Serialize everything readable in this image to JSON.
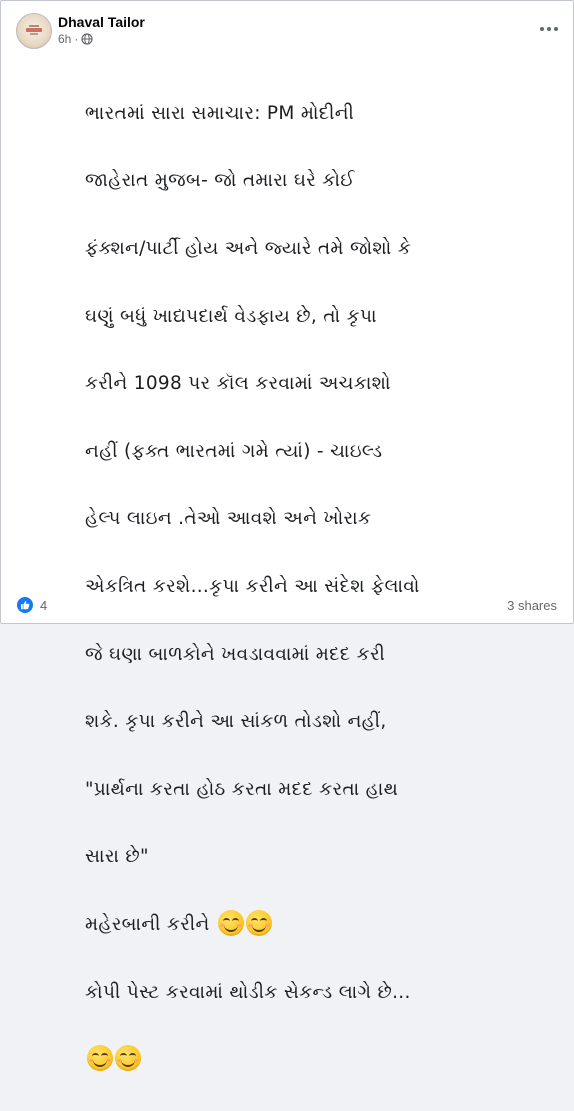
{
  "post": {
    "author": "Dhaval Tailor",
    "time": "6h",
    "privacy_icon": "globe-icon",
    "more_icon": "more-options-icon",
    "lines": [
      "ભારતમાં સારા સમાચાર: PM મોદીની",
      "જાહેરાત મુજબ- જો તમારા ઘરે કોઈ",
      "ફંક્શન/પાર્ટી હોય અને જ્યારે તમે જોશો કે",
      "ઘણું બધું ખાદ્યપદાર્થ વેડફાય છે, તો કૃપા",
      "કરીને 1098 પર કૉલ કરવામાં અચકાશો",
      "નહીં (ફક્ત ભારતમાં ગમે ત્યાં) - ચાઇલ્ડ",
      "હેલ્પ લાઇન .તેઓ આવશે અને ખોરાક",
      "એકત્રિત કરશે...કૃપા કરીને આ સંદેશ ફેલાવો",
      "જે ઘણા બાળકોને ખવડાવવામાં મદદ કરી",
      "શકે. કૃપા કરીને આ સાંકળ તોડશો નહીં,",
      "\"પ્રાર્થના કરતા હોઠ કરતા મદદ કરતા હાથ",
      "સારા છે\"",
      "મહેરબાની કરીને",
      "કોપી પેસ્ટ કરવામાં થોડીક સેકન્ડ લાગે છે..."
    ],
    "emoji_name": "smiling-face-with-smiling-eyes"
  },
  "footer": {
    "like_icon": "like-icon",
    "reaction_count": "4",
    "shares": "3 shares"
  },
  "colors": {
    "like_blue": "#1877f2",
    "text": "#1c1e21",
    "secondary": "#65676b"
  }
}
